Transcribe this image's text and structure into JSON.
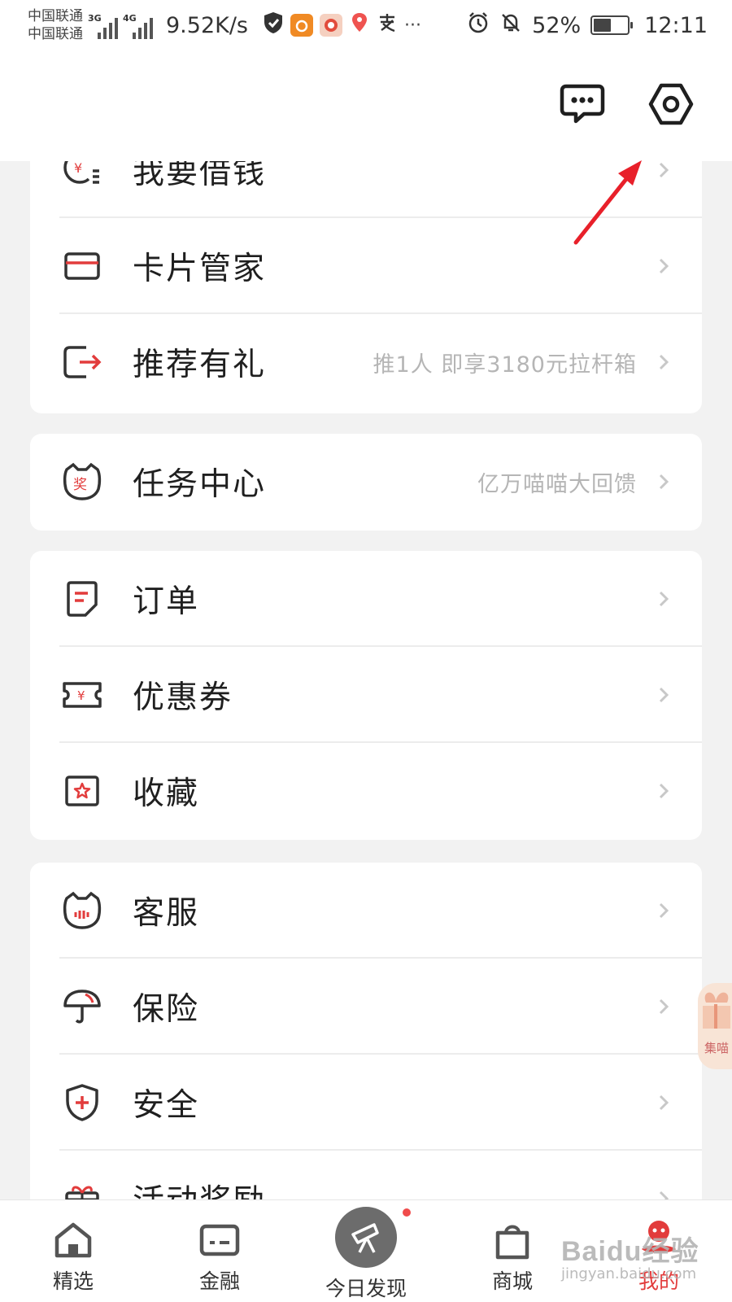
{
  "status": {
    "carriers": [
      "中国联通",
      "中国联通"
    ],
    "net_types": [
      "3G",
      "4G"
    ],
    "speed": "9.52K/s",
    "more": "···",
    "battery": "52%",
    "battery_level": 0.52,
    "time": "12:11"
  },
  "header": {
    "message_icon": "message-icon",
    "settings_icon": "settings-hexagon-icon"
  },
  "groups": [
    {
      "rows": [
        {
          "label": "我要借钱",
          "hint": "",
          "icon": "loan-icon"
        },
        {
          "label": "卡片管家",
          "hint": "",
          "icon": "card-icon"
        },
        {
          "label": "推荐有礼",
          "hint": "推1人 即享3180元拉杆箱",
          "icon": "share-icon"
        }
      ]
    },
    {
      "rows": [
        {
          "label": "任务中心",
          "hint": "亿万喵喵大回馈",
          "icon": "task-cat-icon"
        }
      ]
    },
    {
      "rows": [
        {
          "label": "订单",
          "hint": "",
          "icon": "order-icon"
        },
        {
          "label": "优惠券",
          "hint": "",
          "icon": "coupon-icon"
        },
        {
          "label": "收藏",
          "hint": "",
          "icon": "favorite-icon"
        }
      ]
    },
    {
      "rows": [
        {
          "label": "客服",
          "hint": "",
          "icon": "service-icon"
        },
        {
          "label": "保险",
          "hint": "",
          "icon": "umbrella-icon"
        },
        {
          "label": "安全",
          "hint": "",
          "icon": "shield-icon"
        },
        {
          "label": "活动奖励",
          "hint": "",
          "icon": "gift-icon"
        }
      ]
    }
  ],
  "promo": {
    "label": "集喵"
  },
  "nav": [
    {
      "label": "精选",
      "icon": "home-icon"
    },
    {
      "label": "金融",
      "icon": "finance-card-icon"
    },
    {
      "label": "今日发现",
      "icon": "telescope-icon"
    },
    {
      "label": "商城",
      "icon": "bag-icon"
    },
    {
      "label": "我的",
      "icon": "profile-icon"
    }
  ],
  "watermark": {
    "main": "Baidu经验",
    "sub": "jingyan.baidu.com"
  },
  "colors": {
    "accent": "#e23c3c",
    "annotation_arrow": "#e8202a"
  }
}
